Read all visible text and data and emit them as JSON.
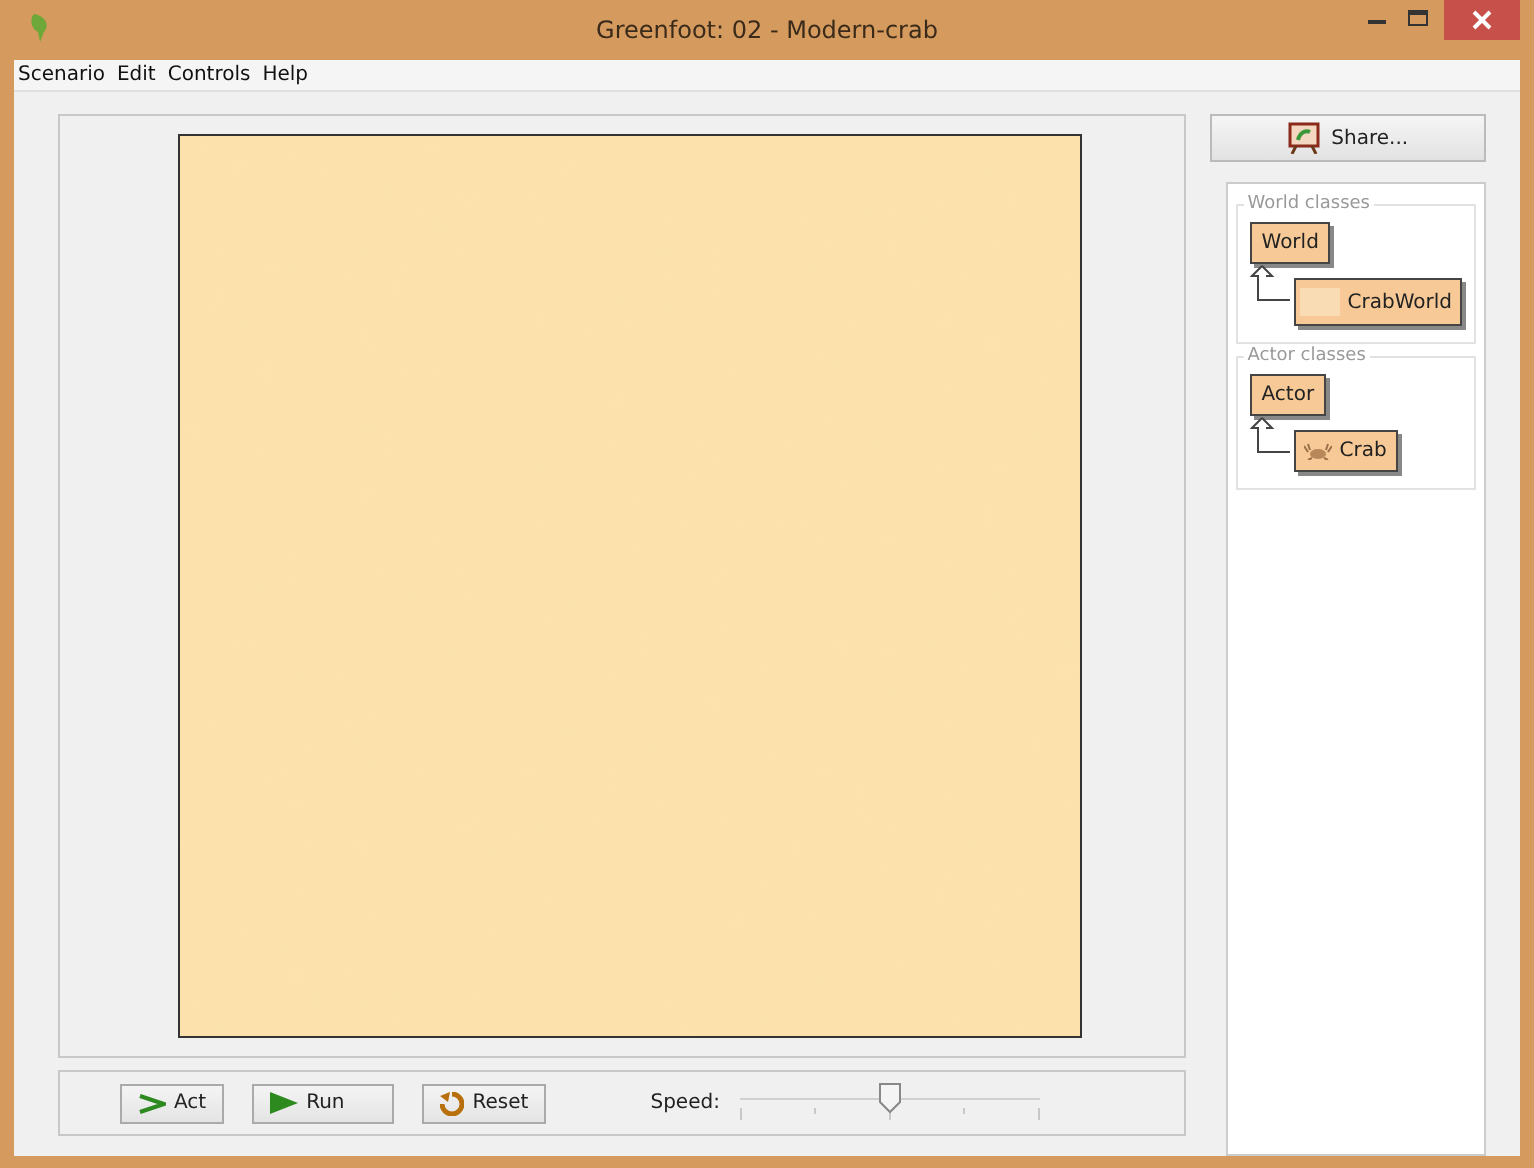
{
  "window": {
    "title": "Greenfoot: 02 - Modern-crab"
  },
  "menu": [
    "Scenario",
    "Edit",
    "Controls",
    "Help"
  ],
  "share_button": {
    "label": "Share..."
  },
  "class_groups": [
    {
      "title": "World classes",
      "classes": [
        {
          "name": "World",
          "kind": "plain",
          "children": [
            {
              "name": "CrabWorld",
              "kind": "blank-image"
            }
          ]
        }
      ]
    },
    {
      "title": "Actor classes",
      "classes": [
        {
          "name": "Actor",
          "kind": "plain",
          "children": [
            {
              "name": "Crab",
              "kind": "crab-image"
            }
          ]
        }
      ]
    }
  ],
  "controls": {
    "buttons": [
      {
        "label": "Act",
        "kind": "act"
      },
      {
        "label": "Run",
        "kind": "run"
      },
      {
        "label": "Reset",
        "kind": "reset"
      }
    ],
    "speed": {
      "label": "Speed:",
      "level": 0.5
    }
  }
}
